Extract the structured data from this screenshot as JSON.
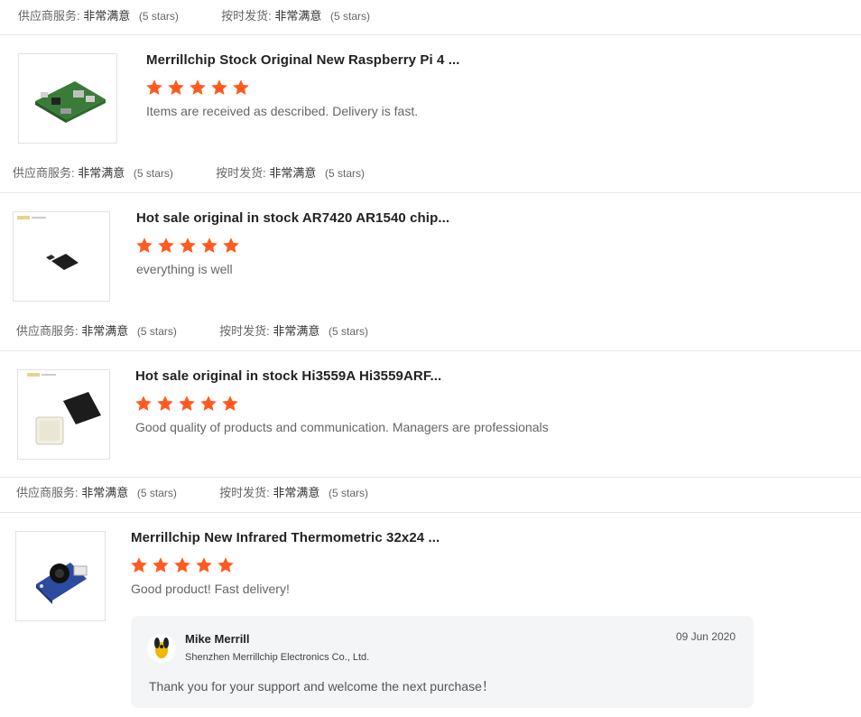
{
  "rating_labels": {
    "supplier_service": "供应商服务:",
    "on_time_delivery": "按时发货:",
    "very_satisfied": "非常满意",
    "stars_text": "(5 stars)"
  },
  "colors": {
    "star": "#ff5a1f",
    "divider": "#e6e6e6"
  },
  "reviews": [
    {
      "product_title": "Merrillchip Stock Original New Raspberry Pi 4 ...",
      "comment": "Items are received as described.  Delivery is fast.",
      "image_icon": "raspberry-pi-board",
      "stars": 5
    },
    {
      "product_title": "Hot sale original in stock AR7420 AR1540 chip...",
      "comment": "everything is well",
      "image_icon": "chip",
      "stars": 5
    },
    {
      "product_title": "Hot sale original in stock Hi3559A Hi3559ARF...",
      "comment": "Good quality of products and communication. Managers are professionals",
      "image_icon": "bga-chip",
      "stars": 5
    },
    {
      "product_title": "Merrillchip New Infrared Thermometric 32x24 ...",
      "comment": "Good product! Fast delivery!",
      "image_icon": "thermal-sensor-module",
      "stars": 5
    }
  ],
  "seller_reply": {
    "name": "Mike Merrill",
    "company": "Shenzhen Merrillchip Electronics Co., Ltd.",
    "date": "09 Jun 2020",
    "text": "Thank you for your support and welcome the next purchase！"
  }
}
